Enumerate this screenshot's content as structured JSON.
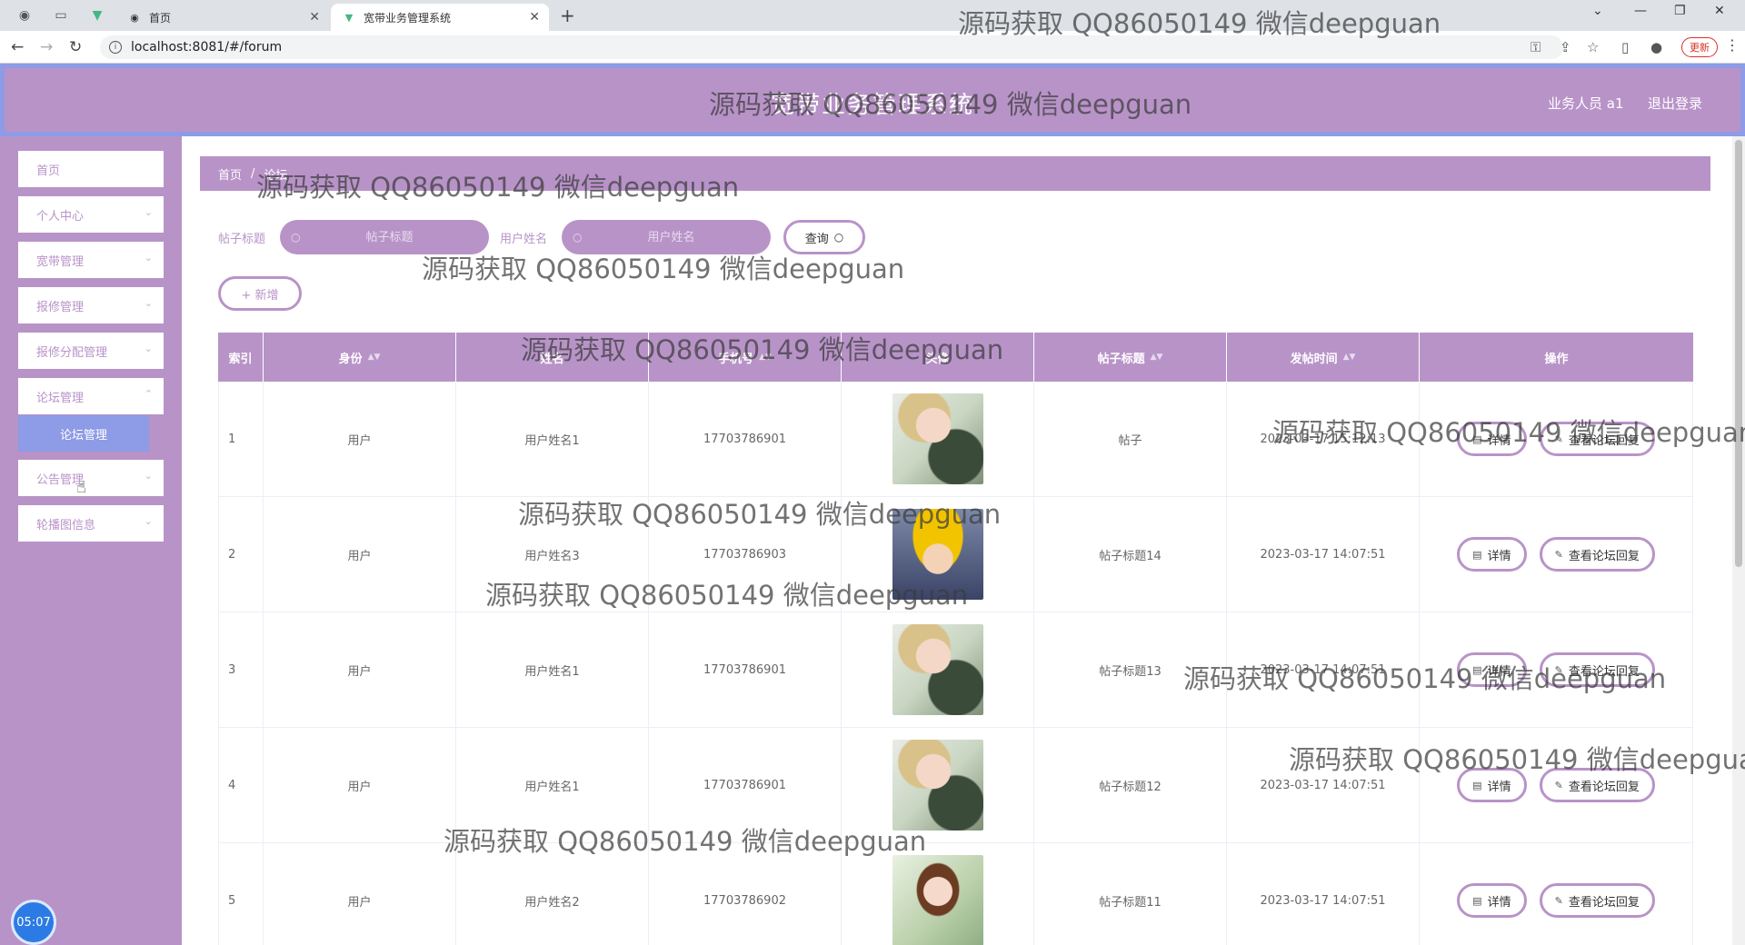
{
  "browser": {
    "tabs": [
      {
        "label": "首页",
        "active": false
      },
      {
        "label": "宽带业务管理系统",
        "active": true
      }
    ],
    "url": "localhost:8081/#/forum",
    "update_label": "更新"
  },
  "header": {
    "title": "宽带业务管理系统",
    "user": "业务人员 a1",
    "logout": "退出登录"
  },
  "sidebar": {
    "items": [
      {
        "label": "首页",
        "has_children": false
      },
      {
        "label": "个人中心",
        "has_children": true
      },
      {
        "label": "宽带管理",
        "has_children": true
      },
      {
        "label": "报修管理",
        "has_children": true
      },
      {
        "label": "报修分配管理",
        "has_children": true
      },
      {
        "label": "论坛管理",
        "has_children": true
      },
      {
        "label": "公告管理",
        "has_children": true
      },
      {
        "label": "轮播图信息",
        "has_children": true
      }
    ],
    "submenu": "论坛管理",
    "clock": "05:07"
  },
  "breadcrumb": {
    "home": "首页",
    "current": "论坛"
  },
  "search": {
    "title_label": "帖子标题",
    "title_placeholder": "帖子标题",
    "user_label": "用户姓名",
    "user_placeholder": "用户姓名",
    "query_label": "查询"
  },
  "add_label": "+ 新增",
  "table": {
    "headers": [
      "索引",
      "身份",
      "姓名",
      "手机号",
      "头像",
      "帖子标题",
      "发帖时间",
      "操作"
    ],
    "detail_label": "详情",
    "reply_label": "查看论坛回复",
    "rows": [
      {
        "index": "1",
        "role": "用户",
        "name": "用户姓名1",
        "phone": "17703786901",
        "avatar": "a",
        "title": "帖子",
        "time": "2023-03-17 15:12:13"
      },
      {
        "index": "2",
        "role": "用户",
        "name": "用户姓名3",
        "phone": "17703786903",
        "avatar": "b",
        "title": "帖子标题14",
        "time": "2023-03-17 14:07:51"
      },
      {
        "index": "3",
        "role": "用户",
        "name": "用户姓名1",
        "phone": "17703786901",
        "avatar": "a",
        "title": "帖子标题13",
        "time": "2023-03-17 14:07:51"
      },
      {
        "index": "4",
        "role": "用户",
        "name": "用户姓名1",
        "phone": "17703786901",
        "avatar": "a",
        "title": "帖子标题12",
        "time": "2023-03-17 14:07:51"
      },
      {
        "index": "5",
        "role": "用户",
        "name": "用户姓名2",
        "phone": "17703786902",
        "avatar": "c",
        "title": "帖子标题11",
        "time": "2023-03-17 14:07:51"
      }
    ]
  },
  "watermark": "源码获取 QQ86050149 微信deepguan",
  "colors": {
    "primary": "#b893c8",
    "accent": "#8e9be6"
  }
}
